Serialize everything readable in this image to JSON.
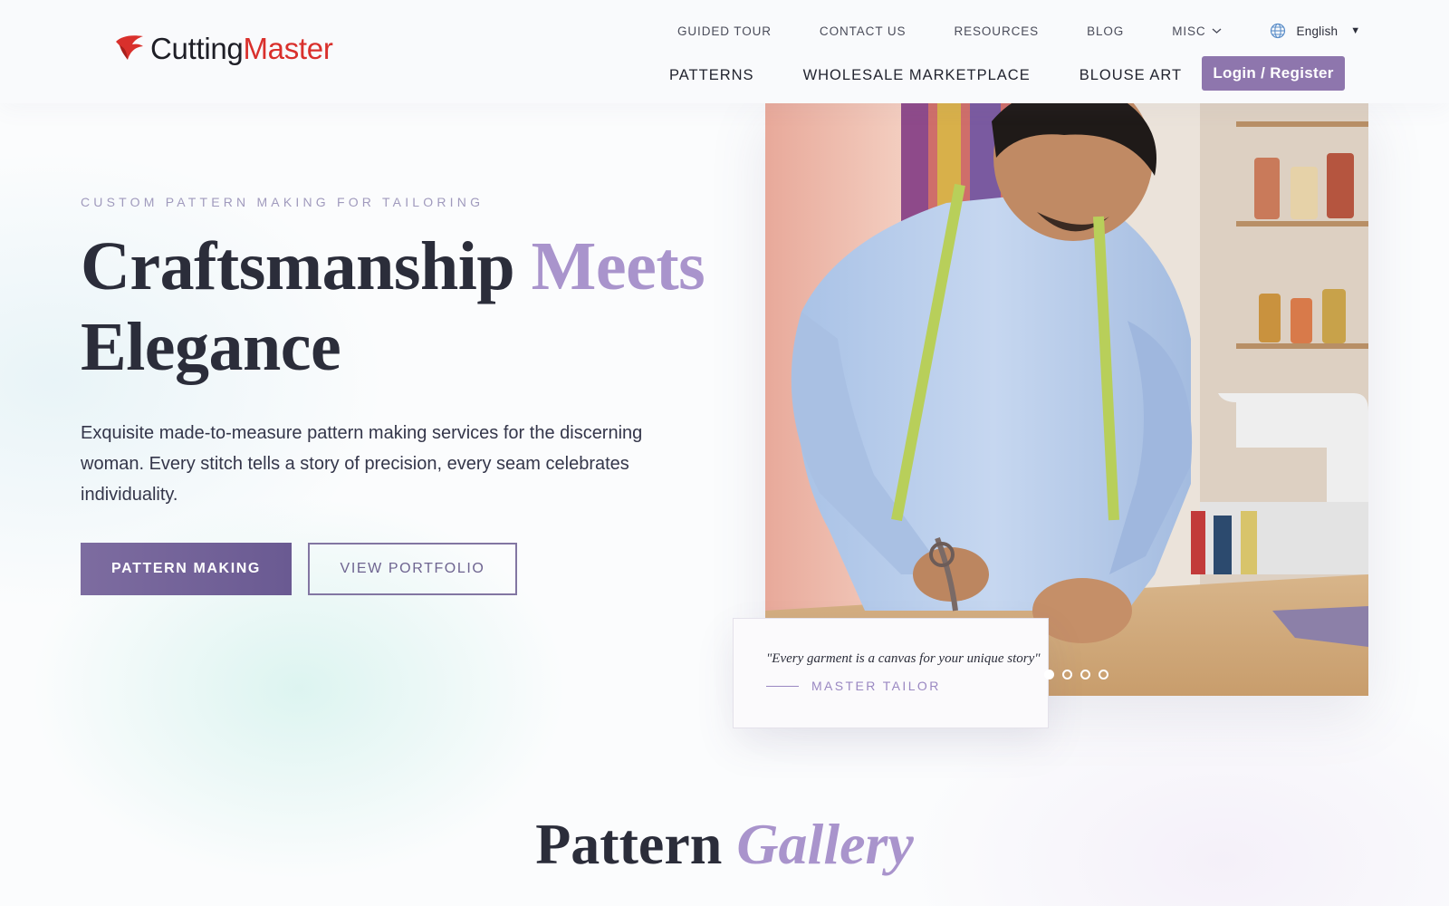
{
  "header": {
    "logo": {
      "part1": "Cutting",
      "part2": "Master"
    },
    "top_nav": [
      "GUIDED TOUR",
      "CONTACT US",
      "RESOURCES",
      "BLOG"
    ],
    "misc_label": "MISC",
    "language": "English",
    "main_nav": [
      "PATTERNS",
      "WHOLESALE MARKETPLACE",
      "BLOUSE ART"
    ],
    "login_label": "Login / Register"
  },
  "hero": {
    "eyebrow": "CUSTOM PATTERN MAKING FOR TAILORING",
    "headline_part1": "Craftsmanship ",
    "headline_accent": "Meets",
    "headline_part2": "Elegance",
    "intro": "Exquisite made-to-measure pattern making services for the discerning woman. Every stitch tells a story of precision, every seam celebrates individuality.",
    "primary_button": "PATTERN MAKING",
    "secondary_button": "VIEW PORTFOLIO",
    "quote": "\"Every garment is a canvas for your unique story\"",
    "quote_author": "MASTER TAILOR",
    "slides": {
      "count": 4,
      "active": 1
    }
  },
  "gallery": {
    "title_part1": "Pattern ",
    "title_accent": "Gallery"
  },
  "colors": {
    "accent": "#a994cc",
    "button": "#7d6ca0",
    "login": "#8e76ad",
    "logo_red": "#d9302c"
  },
  "icons": [
    "bird-logo-icon",
    "chevron-down-icon",
    "globe-icon"
  ]
}
